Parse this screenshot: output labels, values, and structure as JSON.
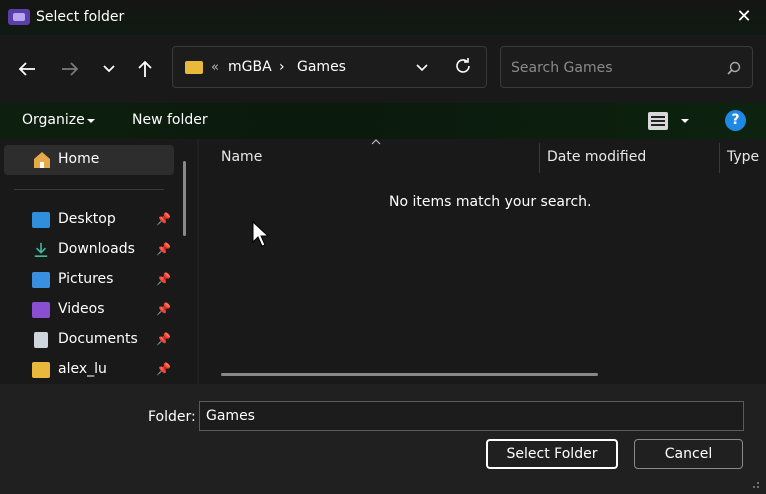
{
  "window": {
    "title": "Select folder",
    "close_glyph": "✕"
  },
  "nav": {
    "back_icon": "arrow-left-icon",
    "forward_icon": "arrow-right-icon",
    "recent_icon": "chevron-down-icon",
    "up_icon": "arrow-up-icon"
  },
  "address": {
    "overflow": "«",
    "crumbs": [
      "mGBA",
      "Games"
    ],
    "separator": "›",
    "refresh_icon": "refresh-icon"
  },
  "search": {
    "placeholder": "Search Games"
  },
  "toolbar": {
    "organize": "Organize",
    "new_folder": "New folder",
    "help": "?"
  },
  "sidebar": {
    "home": "Home",
    "items": [
      {
        "label": "Desktop",
        "icon": "desktop-icon",
        "color": "#2f8fdc"
      },
      {
        "label": "Downloads",
        "icon": "download-icon",
        "color": "#3fb8a0"
      },
      {
        "label": "Pictures",
        "icon": "pictures-icon",
        "color": "#3b8fe0"
      },
      {
        "label": "Videos",
        "icon": "videos-icon",
        "color": "#8a4fd0"
      },
      {
        "label": "Documents",
        "icon": "documents-icon",
        "color": "#cfd6de"
      },
      {
        "label": "alex_lu",
        "icon": "folder-icon",
        "color": "#e8b93a"
      }
    ]
  },
  "columns": [
    "Name",
    "Date modified",
    "Type"
  ],
  "empty_message": "No items match your search.",
  "footer": {
    "folder_label": "Folder:",
    "folder_value": "Games",
    "select_button": "Select Folder",
    "cancel_button": "Cancel"
  }
}
